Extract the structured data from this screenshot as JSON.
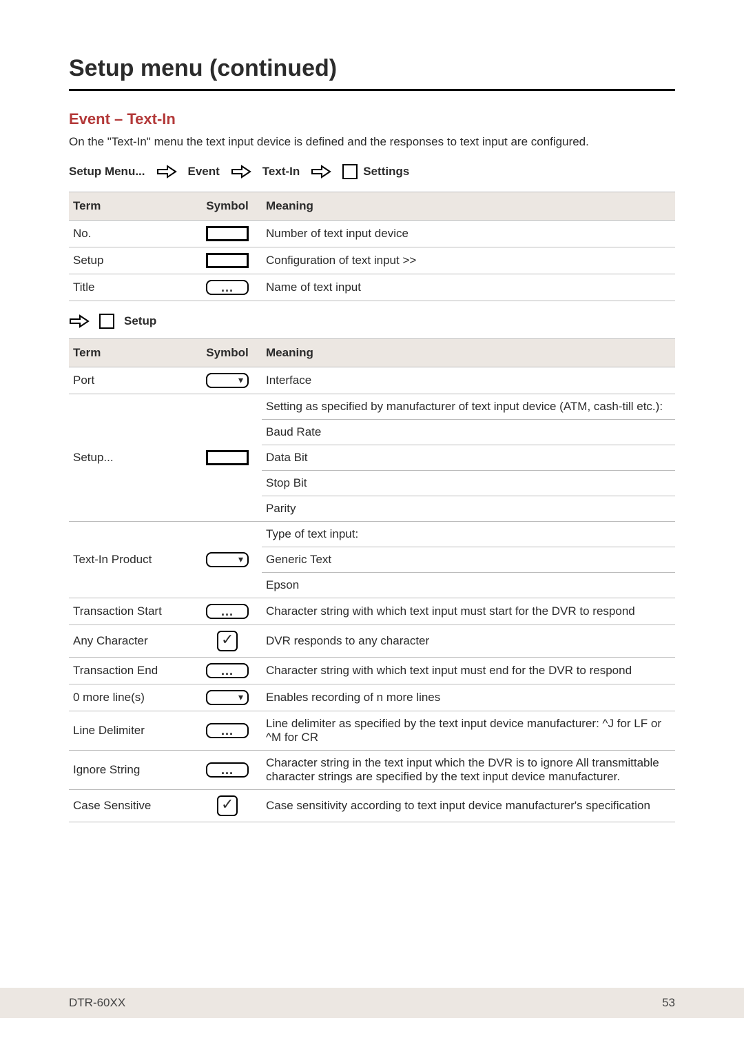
{
  "h1": "Setup menu (continued)",
  "h2": "Event – Text-In",
  "intro": "On the \"Text-In\" menu the text input device is defined and the responses to text input are configured.",
  "crumbs": {
    "setup_menu": "Setup Menu...",
    "event": "Event",
    "text_in": "Text-In",
    "settings": "Settings"
  },
  "headers": {
    "term": "Term",
    "symbol": "Symbol",
    "meaning": "Meaning"
  },
  "table1": {
    "rows": [
      {
        "term": "No.",
        "meaning": "Number of text input device"
      },
      {
        "term": "Setup",
        "meaning": "Configuration of text input >>"
      },
      {
        "term": "Title",
        "meaning": "Name of text input"
      }
    ]
  },
  "midlabel": "Setup",
  "table2": {
    "port": {
      "term": "Port",
      "meaning": "Interface"
    },
    "setup": {
      "term": "Setup...",
      "lead": "Setting as specified by manufacturer of text input device (ATM, cash-till etc.):",
      "items": [
        "Baud Rate",
        "Data Bit",
        "Stop Bit",
        "Parity"
      ]
    },
    "product": {
      "term": "Text-In Product",
      "lead": "Type of text input:",
      "items": [
        "Generic Text",
        "Epson"
      ]
    },
    "tstart": {
      "term": "Transaction Start",
      "meaning": "Character string with which text input must start for the DVR to respond"
    },
    "anychar": {
      "term": "Any Character",
      "meaning": "DVR responds to any character"
    },
    "tend": {
      "term": "Transaction End",
      "meaning": "Character string with which text input must end for the DVR to respond"
    },
    "morelines": {
      "term": "0 more line(s)",
      "meaning": "Enables recording of n more lines"
    },
    "linedelim": {
      "term": "Line Delimiter",
      "meaning": "Line delimiter as specified by the text input device manufacturer: ^J for LF or ^M for CR"
    },
    "ignore": {
      "term": "Ignore String",
      "meaning": "Character string in the text input which the DVR is to ignore All transmittable character strings are specified by the text input device manufacturer."
    },
    "casesens": {
      "term": "Case Sensitive",
      "meaning": "Case sensitivity according to text input device manufacturer's specification"
    }
  },
  "footer": {
    "model": "DTR-60XX",
    "page": "53"
  }
}
